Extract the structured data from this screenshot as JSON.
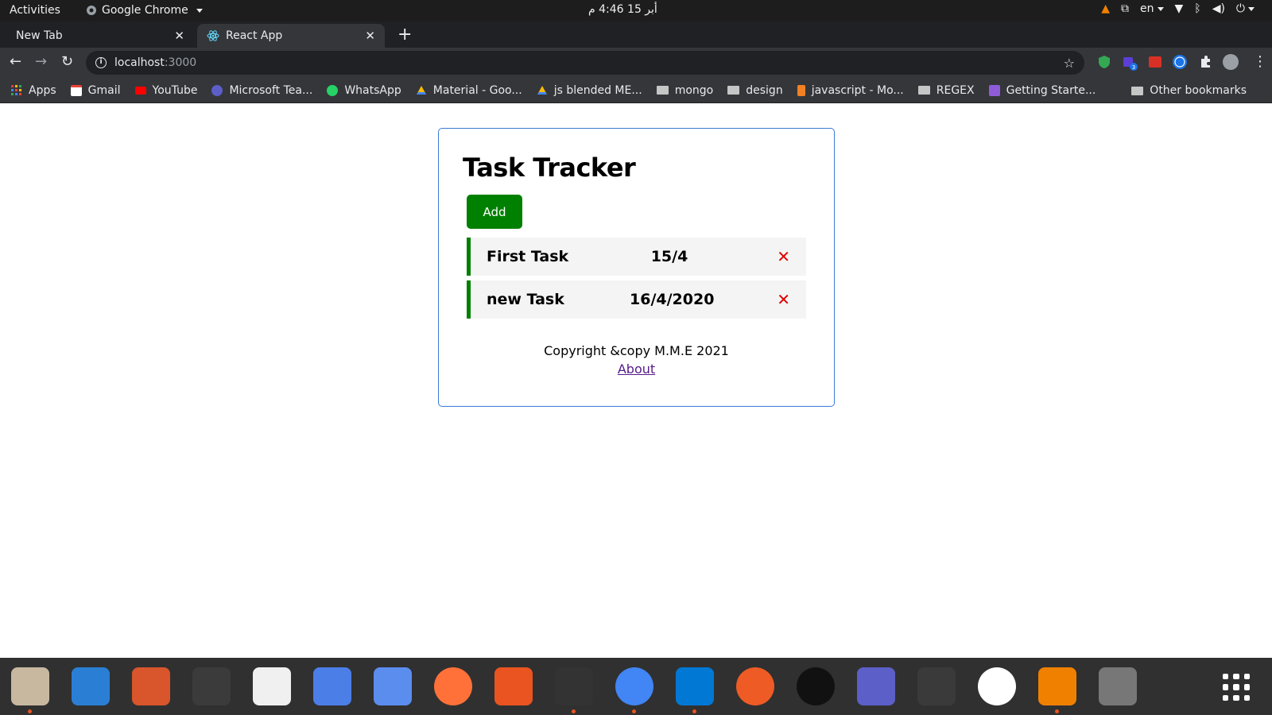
{
  "topbar": {
    "activities": "Activities",
    "app_name": "Google Chrome",
    "clock": "أبر 15  4:46 م",
    "lang": "en"
  },
  "tabs": [
    {
      "label": "New Tab"
    },
    {
      "label": "React App"
    }
  ],
  "omnibox": {
    "host": "localhost",
    "port": ":3000"
  },
  "bookmarks": {
    "items": [
      "Apps",
      "Gmail",
      "YouTube",
      "Microsoft Tea...",
      "WhatsApp",
      "Material - Goo...",
      "js blended ME...",
      "mongo",
      "design",
      "javascript - Mo...",
      "REGEX",
      "Getting Starte..."
    ],
    "other": "Other bookmarks"
  },
  "app": {
    "title": "Task Tracker",
    "add_label": "Add",
    "tasks": [
      {
        "name": "First Task",
        "date": "15/4"
      },
      {
        "name": "new Task",
        "date": "16/4/2020"
      }
    ],
    "delete_glyph": "✕",
    "copyright": "Copyright &copy M.M.E 2021",
    "about": "About"
  },
  "colors": {
    "accent_green": "#008000",
    "delete_red": "#e00000",
    "container_border": "#3a7bd5"
  }
}
